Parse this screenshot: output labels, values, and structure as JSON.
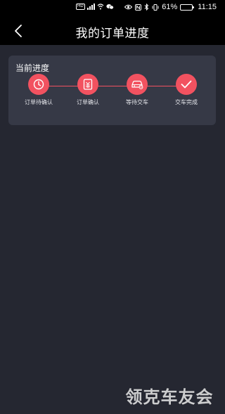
{
  "status_bar": {
    "battery_percent_label": "61%",
    "battery_level": 0.61,
    "time": "11:15",
    "left_icons": [
      "hd-icon",
      "signal-icon",
      "wifi-icon",
      "wechat-icon"
    ],
    "right_icons": [
      "eye-icon",
      "nfc-icon",
      "bluetooth-icon",
      "vibrate-icon",
      "battery-icon"
    ]
  },
  "nav": {
    "title": "我的订单进度",
    "back_icon": "chevron-left-icon"
  },
  "progress_card": {
    "title": "当前进度",
    "accent_color": "#f25260",
    "steps": [
      {
        "label": "订单待确认",
        "icon": "clock-icon"
      },
      {
        "label": "订单确认",
        "icon": "document-icon"
      },
      {
        "label": "等待交车",
        "icon": "car-icon"
      },
      {
        "label": "交车完成",
        "icon": "check-icon"
      }
    ]
  },
  "watermark": "领克车友会"
}
